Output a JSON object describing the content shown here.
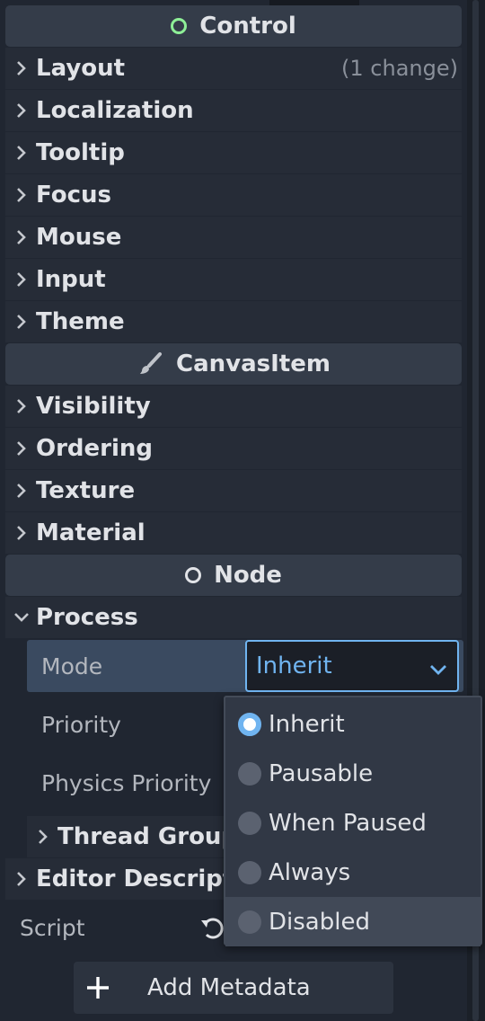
{
  "control": {
    "header": "Control",
    "groups": [
      "Layout",
      "Localization",
      "Tooltip",
      "Focus",
      "Mouse",
      "Input",
      "Theme"
    ],
    "layout_change": "(1 change)"
  },
  "canvas_item": {
    "header": "CanvasItem",
    "groups": [
      "Visibility",
      "Ordering",
      "Texture",
      "Material"
    ]
  },
  "node": {
    "header": "Node",
    "process_group": "Process",
    "mode_label": "Mode",
    "mode_value": "Inherit",
    "priority_label": "Priority",
    "physics_priority_label": "Physics Priority",
    "thread_group": "Thread Group",
    "editor_description": "Editor Descripti"
  },
  "script_label": "Script",
  "add_metadata": "Add Metadata",
  "mode_options": [
    {
      "label": "Inherit",
      "checked": true
    },
    {
      "label": "Pausable",
      "checked": false
    },
    {
      "label": "When Paused",
      "checked": false
    },
    {
      "label": "Always",
      "checked": false
    },
    {
      "label": "Disabled",
      "checked": false
    }
  ],
  "colors": {
    "accent": "#70b4f0",
    "control_icon": "#8eef97",
    "panel_bg": "#202631",
    "header_bg": "#343c49"
  },
  "icons": {
    "control": "ring-icon",
    "canvas_item": "brush-icon",
    "node": "ring-icon",
    "chevron_right": "chevron-right-icon",
    "chevron_down": "chevron-down-icon",
    "reset": "reset-icon",
    "plus": "plus-icon"
  }
}
